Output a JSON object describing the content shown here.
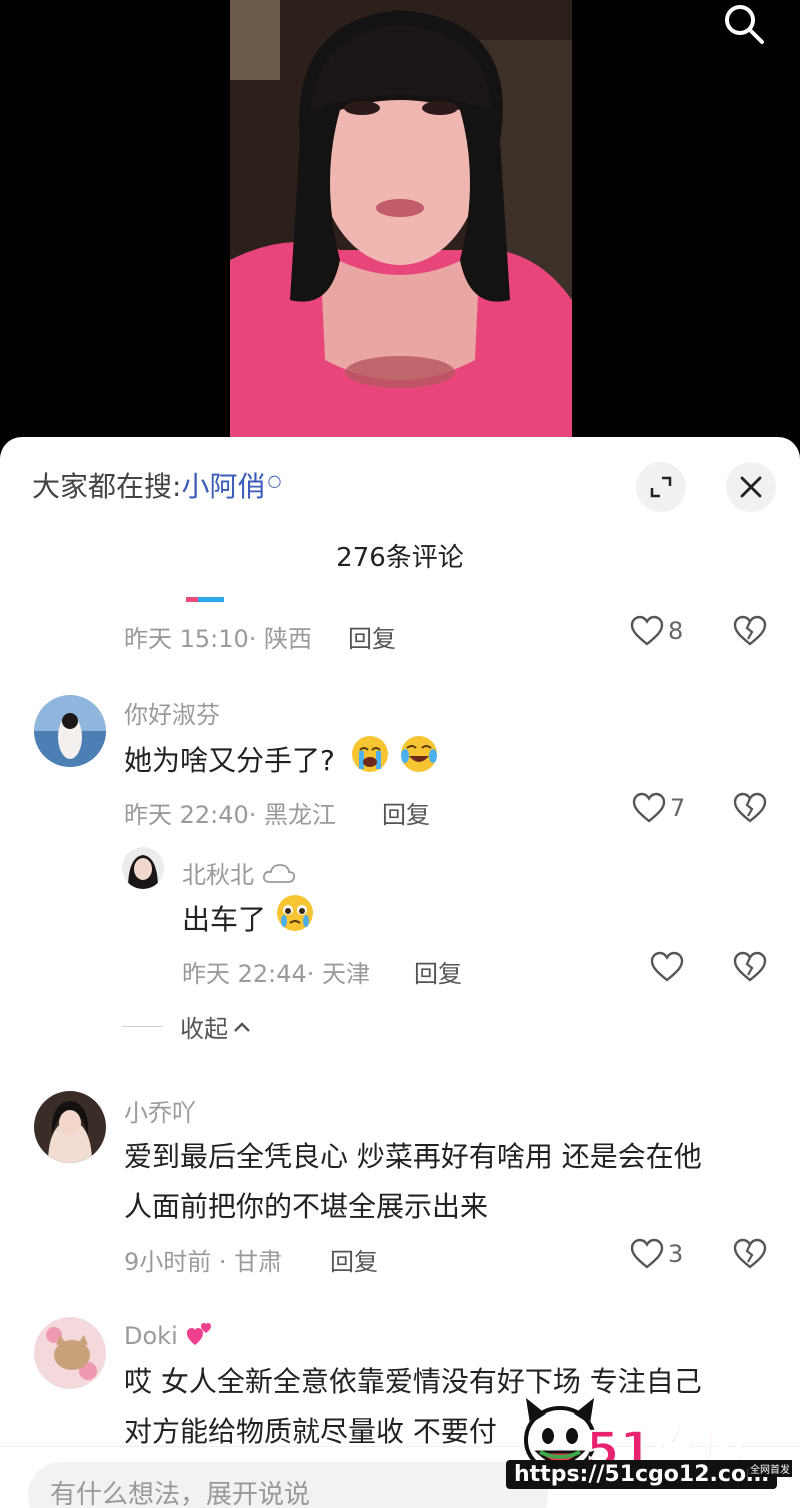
{
  "sheet": {
    "hot_search_prefix": "大家都在搜:",
    "hot_search_keyword": "小阿俏",
    "comment_count": "276条评论"
  },
  "comments": [
    {
      "time": "昨天 15:10· 陕西",
      "reply": "回复",
      "likes": "8"
    },
    {
      "user": "你好淑芬",
      "text": "她为啥又分手了?",
      "time": "昨天 22:40· 黑龙江",
      "reply": "回复",
      "likes": "7",
      "reply_thread": {
        "user": "北秋北",
        "text": "出车了",
        "time": "昨天 22:44· 天津",
        "reply": "回复"
      },
      "collapse": "收起"
    },
    {
      "user": "小乔吖",
      "text_line1": "爱到最后全凭良心 炒菜再好有啥用 还是会在他",
      "text_line2": "人面前把你的不堪全展示出来",
      "time": "9小时前 · 甘肃",
      "reply": "回复",
      "likes": "3"
    },
    {
      "user": "Doki",
      "text_line1": "哎 女人全新全意依靠爱情没有好下场 专注自己",
      "text_line2": "对方能给物质就尽量收 不要付"
    }
  ],
  "input": {
    "placeholder": "有什么想法，展开说说"
  },
  "watermark": {
    "brand": "51吃瓜",
    "url": "https://51cgo12.com",
    "tag": "全网首发"
  },
  "colors": {
    "accent_pink": "#f04a7a",
    "accent_blue": "#2fa8e8",
    "keyword_blue": "#3a5bb8"
  }
}
